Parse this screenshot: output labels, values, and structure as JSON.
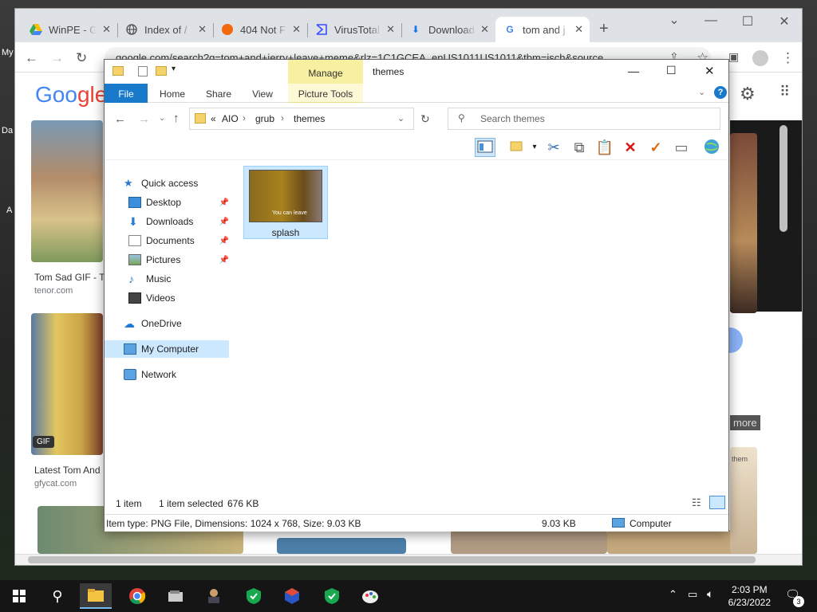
{
  "desktop": {
    "label_my": "My",
    "label_da": "Da",
    "label_a": "A"
  },
  "browser": {
    "tabs": [
      {
        "label": "WinPE - G",
        "icon": "google-drive-icon"
      },
      {
        "label": "Index of /",
        "icon": "globe-icon"
      },
      {
        "label": "404 Not F",
        "icon": "orange-circle-icon"
      },
      {
        "label": "VirusTotal",
        "icon": "virustotal-icon"
      },
      {
        "label": "Download",
        "icon": "download-icon"
      },
      {
        "label": "tom and j",
        "icon": "google-icon"
      }
    ],
    "new_tab": "+",
    "url": "google.com/search?q=tom+and+jerry+leave+meme&rlz=1C1GCEA_enUS1011US1011&tbm=isch&source",
    "google_logo": "Google",
    "results": [
      {
        "caption": "Tom Sad GIF - T",
        "source": "tenor.com"
      },
      {
        "caption": "Latest Tom And",
        "source": "gfycat.com"
      }
    ],
    "gif_badge": "GIF",
    "more_label": "more",
    "them_text": "them"
  },
  "explorer": {
    "title": "themes",
    "manage": "Manage",
    "ribbon_tabs": [
      "File",
      "Home",
      "Share",
      "View",
      "Picture Tools"
    ],
    "breadcrumb": {
      "prefix": "«",
      "parts": [
        "AIO",
        "grub",
        "themes"
      ]
    },
    "search_placeholder": "Search themes",
    "nav": {
      "quick_access": "Quick access",
      "desktop": "Desktop",
      "downloads": "Downloads",
      "documents": "Documents",
      "pictures": "Pictures",
      "music": "Music",
      "videos": "Videos",
      "onedrive": "OneDrive",
      "my_computer": "My Computer",
      "network": "Network"
    },
    "file": {
      "name": "splash",
      "thumb_text": "You can leave"
    },
    "status": {
      "count": "1 item",
      "selected": "1 item selected",
      "size": "676 KB"
    },
    "details": {
      "info": "Item type: PNG File, Dimensions: 1024 x 768, Size: 9.03 KB",
      "size": "9.03 KB",
      "location": "Computer"
    }
  },
  "taskbar": {
    "time": "2:03 PM",
    "date": "6/23/2022",
    "notifications": "3"
  }
}
